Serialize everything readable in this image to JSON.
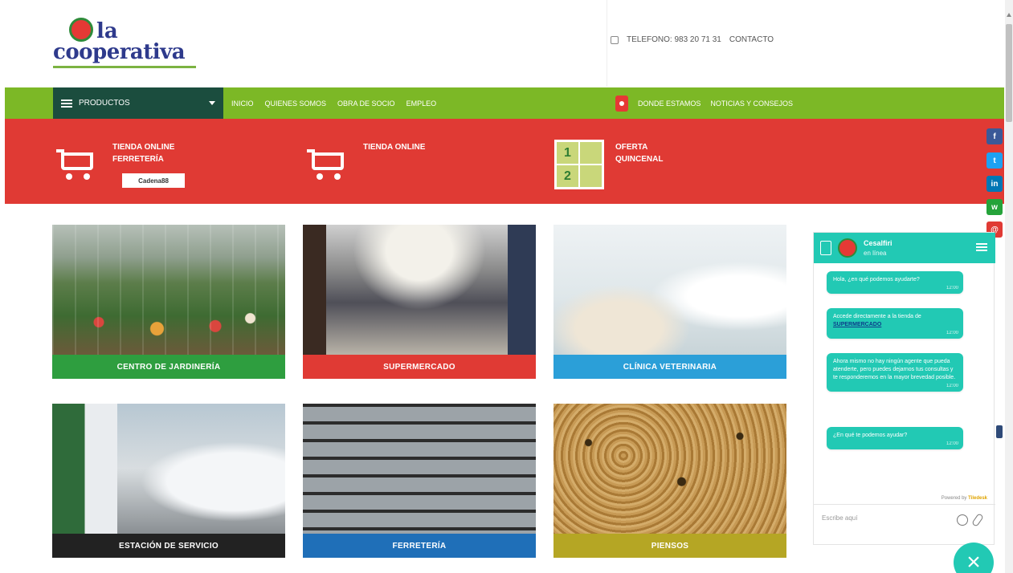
{
  "header": {
    "logo_top": "la",
    "logo_bottom": "cooperativa",
    "phone": "TELEFONO: 983 20 71 31",
    "contact": "CONTACTO"
  },
  "nav": {
    "products": "PRODUCTOS",
    "links": [
      "INICIO",
      "QUIENES SOMOS",
      "OBRA DE SOCIO",
      "EMPLEO"
    ],
    "location": "DONDE ESTAMOS",
    "news": "NOTICIAS Y CONSEJOS"
  },
  "promos": {
    "ferreteria_line1": "TIENDA ONLINE",
    "ferreteria_line2": "FERRETERÍA",
    "ferreteria_brand": "Cadena88",
    "tienda": "TIENDA ONLINE",
    "oferta_line1": "OFERTA",
    "oferta_line2": "QUINCENAL"
  },
  "social": {
    "facebook": "f",
    "twitter": "t",
    "linkedin": "in",
    "whatsapp": "w",
    "email": "@"
  },
  "tiles": [
    {
      "label": "CENTRO DE JARDINERÍA",
      "color": "#2e9e3f"
    },
    {
      "label": "SUPERMERCADO",
      "color": "#e03a34"
    },
    {
      "label": "CLÍNICA VETERINARIA",
      "color": "#2b9fd8"
    },
    {
      "label": "ESTACIÓN DE SERVICIO",
      "color": "#222222"
    },
    {
      "label": "FERRETERÍA",
      "color": "#1f6fb8"
    },
    {
      "label": "PIENSOS",
      "color": "#b5a624"
    }
  ],
  "chat": {
    "name": "Cesalfiri",
    "status": "en línea",
    "messages": [
      {
        "text": "Hola, ¿en qué podemos ayudarte?",
        "time": "12:00"
      },
      {
        "text": "Accede directamente a la tienda de",
        "link": "SUPERMERCADO",
        "time": "12:00"
      },
      {
        "text": "Ahora mismo no hay ningún agente que pueda atenderte, pero puedes dejarnos tus consultas y te responderemos en la mayor brevedad posible.",
        "time": "12:00"
      },
      {
        "text": "¿En qué te podemos ayudar?",
        "time": "12:00"
      }
    ],
    "powered_by": "Powered by",
    "powered_brand": "Tiledesk",
    "input_placeholder": "Escribe aquí",
    "close": "×"
  }
}
